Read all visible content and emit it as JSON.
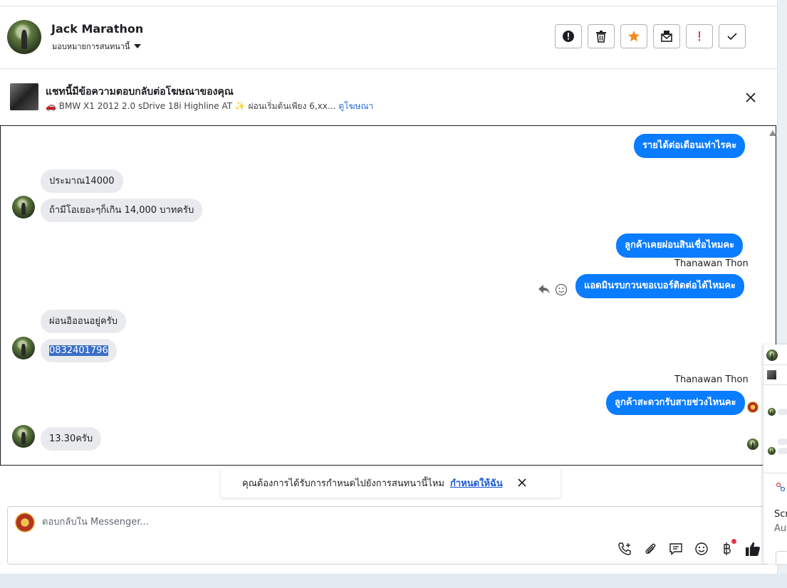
{
  "header": {
    "contact_name": "Jack Marathon",
    "assign_label": "มอบหมายการสนทนานี้",
    "actions": [
      {
        "icon": "alert-circle-icon",
        "color": "#1c1e21"
      },
      {
        "icon": "trash-icon",
        "color": "#1c1e21"
      },
      {
        "icon": "star-icon",
        "color": "#f28b1a"
      },
      {
        "icon": "mail-icon",
        "color": "#1c1e21"
      },
      {
        "icon": "exclamation-icon",
        "color": "#e4374b"
      },
      {
        "icon": "check-icon",
        "color": "#1c1e21"
      }
    ]
  },
  "ad_banner": {
    "title": "แชทนี้มีข้อความตอบกลับต่อโฆษณาของคุณ",
    "subtitle": "🚗 BMW X1 2012 2.0 sDrive 18i Highline AT ✨ ผ่อนเริ่มต้นเพียง 6,xx...",
    "link": "ดูโฆษณา"
  },
  "messages": {
    "m1": "รายได้ต่อเดือนเท่าไรคะ",
    "m2": "ประมาณ14000",
    "m3": "ถ้ามีโอเยอะๆก็เกิน 14,000 บาทครับ",
    "m4": "ลูกค้าเคยผ่อนสินเชื่อไหมคะ",
    "m5_sender": "Thanawan Thon",
    "m5": "แอดมินรบกวนขอเบอร์ติดต่อได้ไหมคะ",
    "m6": "ผ่อนอิออนอยู่ครับ",
    "m7": "0832401796",
    "m8_sender": "Thanawan Thon",
    "m8": "ลูกค้าสะดวกรับสายช่วงไหนคะ",
    "m9": "13.30ครับ"
  },
  "suggestion": {
    "text": "คุณต้องการได้รับการกำหนดไปยังการสนทนานี้ไหม",
    "link": "กำหนดให้ฉัน"
  },
  "composer": {
    "placeholder": "ตอบกลับใน Messenger..."
  },
  "mini_panel": {
    "text1": "Scr",
    "text2": "Aut"
  },
  "colors": {
    "outgoing_bubble": "#0a7cff",
    "incoming_bubble": "#e9eaed",
    "link": "#1a56d6"
  }
}
